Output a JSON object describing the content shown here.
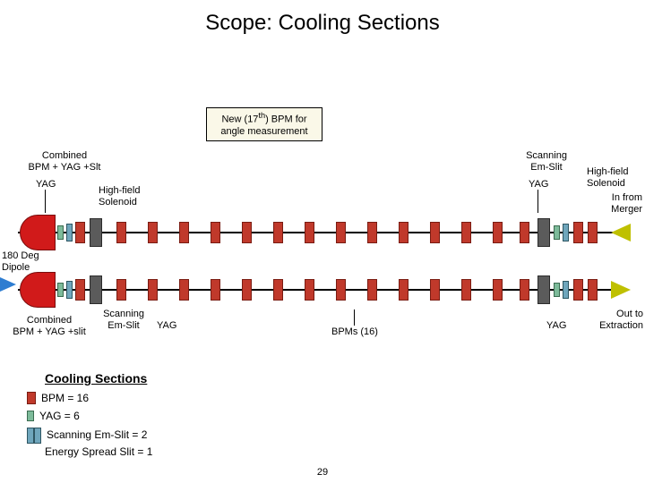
{
  "title": "Scope: Cooling Sections",
  "page_number": "29",
  "callouts": {
    "new_bpm": {
      "line1": "New (17",
      "sup": "th",
      "line1b": ") BPM for",
      "line2": "angle measurement"
    }
  },
  "top": {
    "combined": {
      "line1": "Combined",
      "line2": "BPM + YAG +Slt"
    },
    "yag_left": "YAG",
    "hf_solenoid_left": {
      "line1": "High-field",
      "line2": "Solenoid"
    },
    "scanning_em_slit": {
      "line1": "Scanning",
      "line2": "Em-Slit"
    },
    "yag_right": "YAG",
    "hf_solenoid_right": {
      "line1": "High-field",
      "line2": "Solenoid"
    },
    "in_from_merger": {
      "line1": "In from",
      "line2": "Merger"
    }
  },
  "mid": {
    "dipole": {
      "line1": "180 Deg",
      "line2": "Dipole"
    }
  },
  "bot": {
    "combined": {
      "line1": "Combined",
      "line2": "BPM + YAG +slit"
    },
    "scanning": {
      "line1": "Scanning",
      "line2": "Em-Slit"
    },
    "yag_left": "YAG",
    "bpms": "BPMs (16)",
    "yag_right": "YAG",
    "out": {
      "line1": "Out to",
      "line2": "Extraction"
    }
  },
  "legend": {
    "title": "Cooling Sections",
    "bpm": "BPM = 16",
    "yag": "YAG = 6",
    "scanning": "Scanning Em-Slit = 2",
    "energy": "Energy Spread Slit = 1"
  }
}
